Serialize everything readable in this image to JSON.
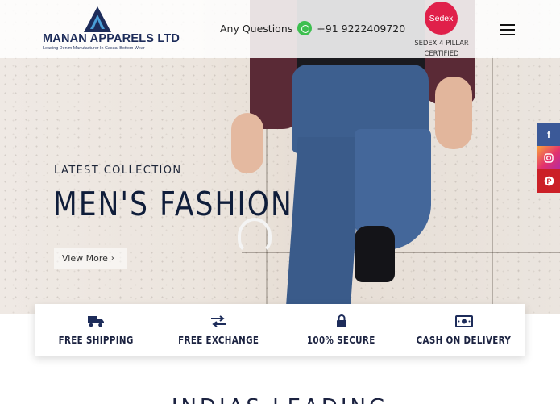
{
  "header": {
    "brand_name": "MANAN APPARELS LTD",
    "tagline": "Leading Denim Manufacturer In Casual Bottom Wear",
    "contact_prefix": "Any Questions",
    "phone": "+91 9222409720",
    "sedex_logo_text": "Sedex",
    "sedex_caption": "SEDEX 4 PILLAR CERTIFIED"
  },
  "hero": {
    "eyebrow": "LATEST COLLECTION",
    "title": "MEN'S FASHION",
    "cta_label": "View More"
  },
  "social": {
    "facebook": "f",
    "instagram": "ig",
    "pinterest": "p"
  },
  "features": [
    {
      "label": "FREE SHIPPING",
      "icon": "truck-icon"
    },
    {
      "label": "FREE EXCHANGE",
      "icon": "exchange-arrows-icon"
    },
    {
      "label": "100% SECURE",
      "icon": "lock-icon"
    },
    {
      "label": "CASH ON DELIVERY",
      "icon": "cash-icon"
    }
  ],
  "next_section": {
    "heading": "INDIAS LEADING"
  },
  "colors": {
    "brand_navy": "#1d2c5a",
    "whatsapp_green": "#3dbf4f",
    "sedex_red": "#e0204a",
    "facebook_blue": "#3b5998",
    "pinterest_red": "#cb2027"
  }
}
